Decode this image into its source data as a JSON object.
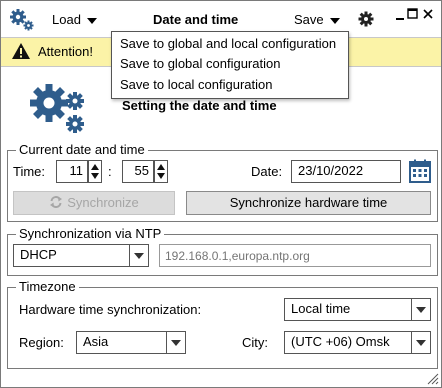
{
  "toolbar": {
    "load_label": "Load",
    "title": "Date and time",
    "save_label": "Save",
    "icons": [
      "gears-icon",
      "gear-icon",
      "minimize-icon",
      "maximize-icon",
      "close-icon"
    ]
  },
  "attention": {
    "label": "Attention!",
    "icon": "warning-icon",
    "color": "#fbf3a7"
  },
  "save_menu": {
    "items": [
      "Save to global and local configuration",
      "Save to global configuration",
      "Save to local configuration"
    ]
  },
  "header": {
    "title": "Setting the date and time",
    "icon": "gears-icon",
    "icon_color": "#2f5d8c"
  },
  "current": {
    "legend": "Current date and time",
    "time_label": "Time:",
    "hour": "11",
    "separator": ":",
    "minute": "55",
    "date_label": "Date:",
    "date_value": "23/10/2022",
    "sync_button": "Synchronize",
    "sync_hw_button": "Synchronize hardware time"
  },
  "ntp": {
    "legend": "Synchronization via NTP",
    "mode": "DHCP",
    "servers_placeholder": "192.168.0.1,europa.ntp.org"
  },
  "timezone": {
    "legend": "Timezone",
    "hw_sync_label": "Hardware time synchronization:",
    "hw_sync_value": "Local time",
    "region_label": "Region:",
    "region_value": "Asia",
    "city_label": "City:",
    "city_value": "(UTC +06) Omsk"
  }
}
